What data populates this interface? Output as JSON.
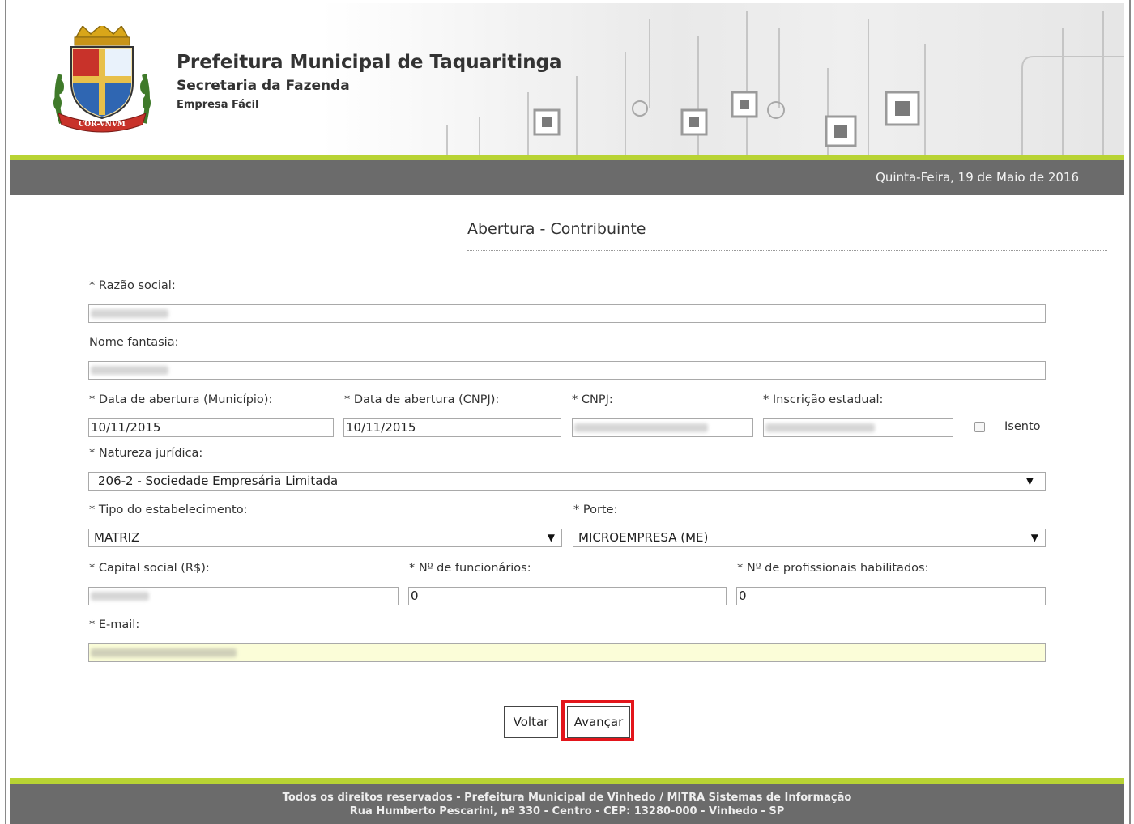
{
  "header": {
    "title": "Prefeitura Municipal de Taquaritinga",
    "subtitle": "Secretaria da Fazenda",
    "app_name": "Empresa Fácil",
    "crest_text": "COR-VNVM",
    "date": "Quinta-Feira, 19 de Maio de 2016"
  },
  "page": {
    "title": "Abertura - Contribuinte"
  },
  "form": {
    "razao_social_label": "* Razão social:",
    "nome_fantasia_label": "Nome fantasia:",
    "data_abertura_municipio_label": "* Data de abertura (Município):",
    "data_abertura_municipio_value": "10/11/2015",
    "data_abertura_cnpj_label": "* Data de abertura (CNPJ):",
    "data_abertura_cnpj_value": "10/11/2015",
    "cnpj_label": "* CNPJ:",
    "inscricao_estadual_label": "* Inscrição estadual:",
    "isento_label": "Isento",
    "natureza_juridica_label": "* Natureza jurídica:",
    "natureza_juridica_value": "206-2 - Sociedade Empresária Limitada",
    "tipo_estabelecimento_label": "* Tipo do estabelecimento:",
    "tipo_estabelecimento_value": "MATRIZ",
    "porte_label": "* Porte:",
    "porte_value": "MICROEMPRESA (ME)",
    "capital_social_label": "* Capital social (R$):",
    "num_funcionarios_label": "* Nº de funcionários:",
    "num_funcionarios_value": "0",
    "num_profissionais_label": "* Nº de profissionais habilitados:",
    "num_profissionais_value": "0",
    "email_label": "* E-mail:"
  },
  "buttons": {
    "back": "Voltar",
    "next": "Avançar"
  },
  "footer": {
    "line1": "Todos os direitos reservados - Prefeitura Municipal de Vinhedo / MITRA Sistemas de Informação",
    "line2": "Rua Humberto Pescarini, nº 330 - Centro - CEP: 13280-000 - Vinhedo - SP"
  },
  "colors": {
    "accent_green": "#b8d334",
    "bar_gray": "#6b6b6b",
    "highlight_red": "#e3151b",
    "email_field_bg": "#fbfdd8"
  }
}
